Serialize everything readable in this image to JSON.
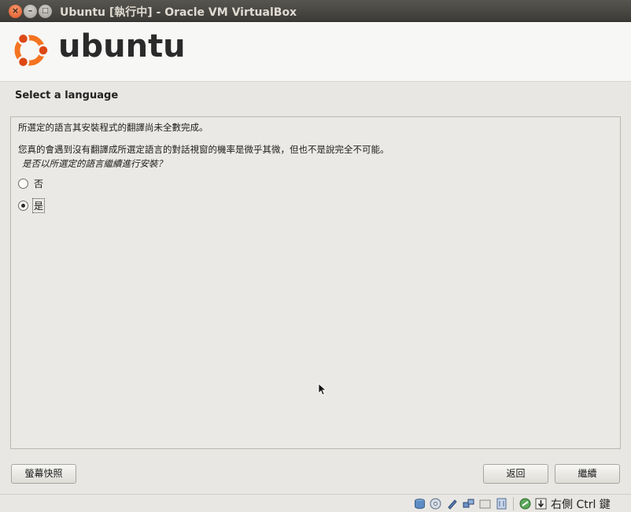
{
  "window": {
    "title": "Ubuntu [執行中] - Oracle VM VirtualBox",
    "close_glyph": "×",
    "minimize_glyph": "–",
    "maximize_glyph": "□"
  },
  "banner": {
    "logo_text": "ubuntu",
    "colors": {
      "orange": "#dd4814",
      "ring": "#f47421"
    }
  },
  "page": {
    "heading": "Select a language"
  },
  "dialog": {
    "line1": "所選定的語言其安裝程式的翻譯尚未全數完成。",
    "line2": "您真的會遇到沒有翻譯成所選定語言的對話視窗的機率是微乎其微，但也不是說完全不可能。",
    "question": " 是否以所選定的語言繼續進行安裝？",
    "options": [
      {
        "label": "否",
        "selected": false
      },
      {
        "label": "是",
        "selected": true
      }
    ]
  },
  "buttons": {
    "screenshot": "螢幕快照",
    "back": "返回",
    "continue": "繼續"
  },
  "statusbar": {
    "icons": [
      "hard-disk-icon",
      "optical-disc-icon",
      "usb-icon",
      "network-icon",
      "shared-folder-icon",
      "video-capture-icon",
      "virtualization-icon",
      "mouse-integration-icon"
    ],
    "host_key": "右側 Ctrl 鍵"
  }
}
